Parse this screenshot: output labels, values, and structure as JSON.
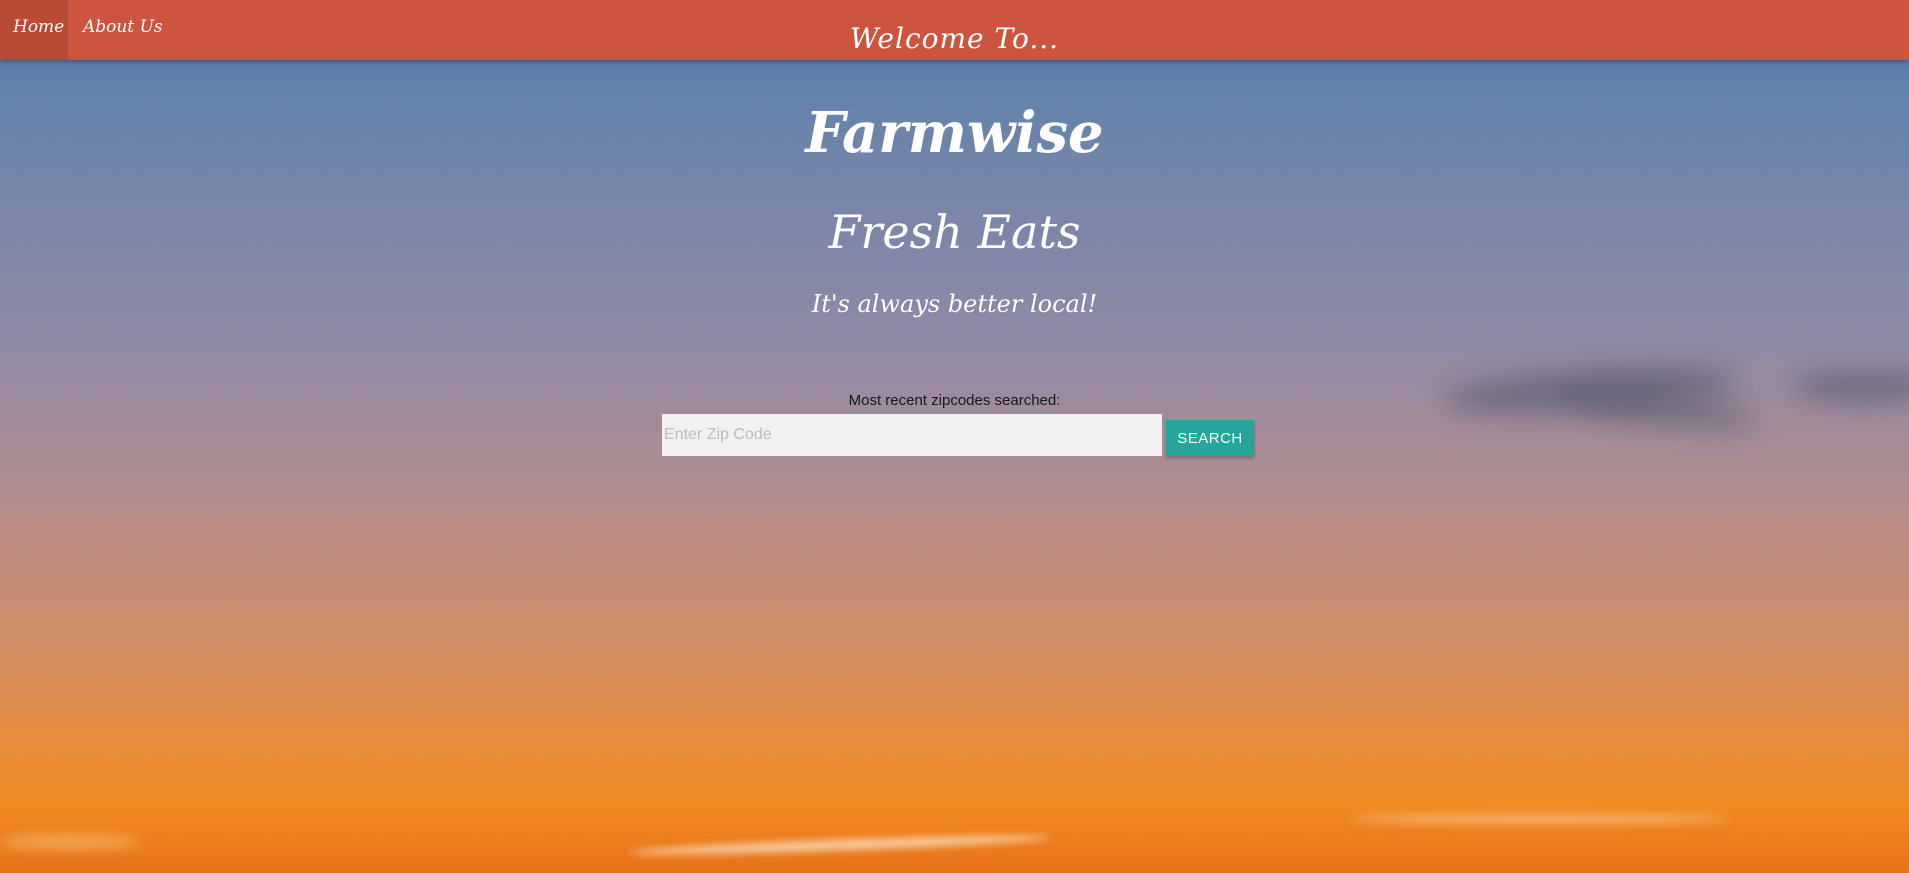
{
  "nav": {
    "home_label": "Home",
    "about_label": "About Us",
    "title": "Welcome To..."
  },
  "hero": {
    "brand": "Farmwise",
    "tagline": "Fresh Eats",
    "subtitle": "It's always better local!"
  },
  "search": {
    "recent_label": "Most recent zipcodes searched:",
    "placeholder": "Enter Zip Code",
    "value": "",
    "button_label": "SEARCH"
  },
  "colors": {
    "navbar": "#cd543e",
    "nav_active": "#b84a36",
    "button": "#26a69a",
    "input_bg": "#f2f0f1"
  }
}
